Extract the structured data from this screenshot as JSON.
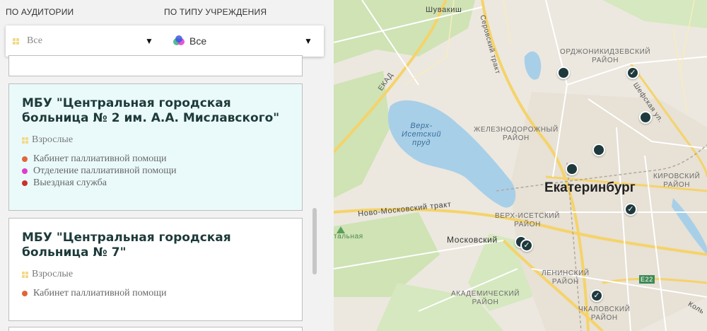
{
  "filters": {
    "audience_label": "ПО АУДИТОРИИ",
    "institution_label": "ПО ТИПУ УЧРЕЖДЕНИЯ",
    "audience_value": "Все",
    "institution_value": "Все"
  },
  "cards": [
    {
      "title_line1": "МБУ \"Центральная городская",
      "title_line2": "больница № 2 им. А.А. Миславского\"",
      "audience": "Взрослые",
      "services": [
        {
          "label": "Кабинет паллиативной помощи",
          "color": "#e0663a"
        },
        {
          "label": "Отделение паллиативной помощи",
          "color": "#e03bd0"
        },
        {
          "label": "Выездная служба",
          "color": "#c8322a"
        }
      ]
    },
    {
      "title_line1": "МБУ \"Центральная городская",
      "title_line2": "больница № 7\"",
      "audience": "Взрослые",
      "services": [
        {
          "label": "Кабинет паллиативной помощи",
          "color": "#e0663a"
        }
      ]
    }
  ],
  "map": {
    "city": "Екатеринбург",
    "labels": {
      "shuvakish": "Шувакиш",
      "serovsky": "Серовский тракт",
      "ekad": "ЕКАД",
      "ordzhonikidze": "ОРДЖОНИКИДЗЕВСКИЙ\nРАЙОН",
      "shefskaya": "Шефская ул.",
      "pond": "Верх-\nИсетский\nпруд",
      "zheleznodor": "ЖЕЛЕЗНОДОРОЖНЫЙ\nРАЙОН",
      "kirovsky": "КИРОВСКИЙ\nРАЙОН",
      "novomoskovsky": "Ново-Московский тракт",
      "verkhisetsky": "ВЕРХ-ИСЕТСКИЙ\nРАЙОН",
      "moskovsky": "Московский",
      "talnaya": "тальная",
      "leninsky": "ЛЕНИНСКИЙ\nРАЙОН",
      "e22": "E22",
      "akademichesky": "АКАДЕМИЧЕСКИЙ\nРАЙОН",
      "chkalovsky": "ЧКАЛОВСКИЙ\nРАЙОН",
      "kolts": "Коль"
    }
  }
}
